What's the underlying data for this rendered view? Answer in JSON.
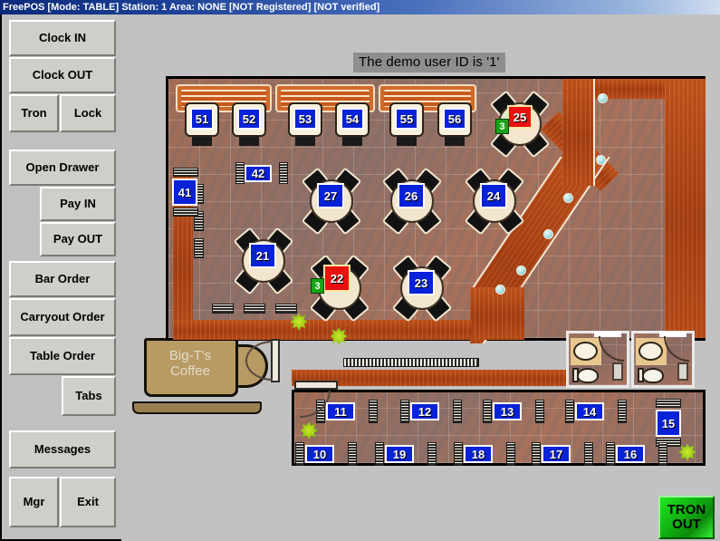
{
  "window": {
    "title": "FreePOS [Mode: TABLE] Station: 1 Area: NONE [NOT Registered] [NOT verified]"
  },
  "sidebar": {
    "buttons": [
      {
        "label": "Clock IN",
        "name": "clock-in-button"
      },
      {
        "label": "Clock OUT",
        "name": "clock-out-button"
      },
      {
        "label": "Tron",
        "name": "tron-button"
      },
      {
        "label": "Lock",
        "name": "lock-button"
      },
      {
        "label": "Open Drawer",
        "name": "open-drawer-button"
      },
      {
        "label": "Pay IN",
        "name": "pay-in-button"
      },
      {
        "label": "Pay OUT",
        "name": "pay-out-button"
      },
      {
        "label": "Bar Order",
        "name": "bar-order-button"
      },
      {
        "label": "Carryout Order",
        "name": "carryout-order-button"
      },
      {
        "label": "Table Order",
        "name": "table-order-button"
      },
      {
        "label": "Tabs",
        "name": "tabs-button"
      },
      {
        "label": "Messages",
        "name": "messages-button"
      },
      {
        "label": "Mgr",
        "name": "mgr-button"
      },
      {
        "label": "Exit",
        "name": "exit-button"
      }
    ]
  },
  "main": {
    "banner": "The demo user ID is '1'",
    "tron_out_line1": "TRON",
    "tron_out_line2": "OUT"
  },
  "logo": {
    "line1": "Big-T's",
    "line2": "Coffee"
  },
  "colors": {
    "table_free": "#0822d8",
    "table_occupied": "#e81010",
    "guest_badge": "#17a417",
    "titlebar": "#1b3f95",
    "tron_out": "#12b512",
    "floor_wood": "#bf4d18"
  },
  "floor_plan": {
    "tables": [
      {
        "id": "51",
        "status": "free",
        "guests": null,
        "shape": "booth"
      },
      {
        "id": "52",
        "status": "free",
        "guests": null,
        "shape": "booth"
      },
      {
        "id": "53",
        "status": "free",
        "guests": null,
        "shape": "booth"
      },
      {
        "id": "54",
        "status": "free",
        "guests": null,
        "shape": "booth"
      },
      {
        "id": "55",
        "status": "free",
        "guests": null,
        "shape": "booth"
      },
      {
        "id": "56",
        "status": "free",
        "guests": null,
        "shape": "booth"
      },
      {
        "id": "25",
        "status": "occupied",
        "guests": "3",
        "shape": "round"
      },
      {
        "id": "41",
        "status": "free",
        "guests": null,
        "shape": "wall"
      },
      {
        "id": "42",
        "status": "free",
        "guests": null,
        "shape": "wall"
      },
      {
        "id": "27",
        "status": "free",
        "guests": null,
        "shape": "round"
      },
      {
        "id": "26",
        "status": "free",
        "guests": null,
        "shape": "round"
      },
      {
        "id": "24",
        "status": "free",
        "guests": null,
        "shape": "round"
      },
      {
        "id": "21",
        "status": "free",
        "guests": null,
        "shape": "round"
      },
      {
        "id": "22",
        "status": "occupied",
        "guests": "3",
        "shape": "round"
      },
      {
        "id": "23",
        "status": "free",
        "guests": null,
        "shape": "round"
      },
      {
        "id": "11",
        "status": "free",
        "guests": null,
        "shape": "wall"
      },
      {
        "id": "12",
        "status": "free",
        "guests": null,
        "shape": "wall"
      },
      {
        "id": "13",
        "status": "free",
        "guests": null,
        "shape": "wall"
      },
      {
        "id": "14",
        "status": "free",
        "guests": null,
        "shape": "wall"
      },
      {
        "id": "15",
        "status": "free",
        "guests": null,
        "shape": "wall"
      },
      {
        "id": "10",
        "status": "free",
        "guests": null,
        "shape": "wall"
      },
      {
        "id": "19",
        "status": "free",
        "guests": null,
        "shape": "wall"
      },
      {
        "id": "18",
        "status": "free",
        "guests": null,
        "shape": "wall"
      },
      {
        "id": "17",
        "status": "free",
        "guests": null,
        "shape": "wall"
      },
      {
        "id": "16",
        "status": "free",
        "guests": null,
        "shape": "wall"
      }
    ],
    "bar_stools": 6,
    "restrooms": 2
  }
}
